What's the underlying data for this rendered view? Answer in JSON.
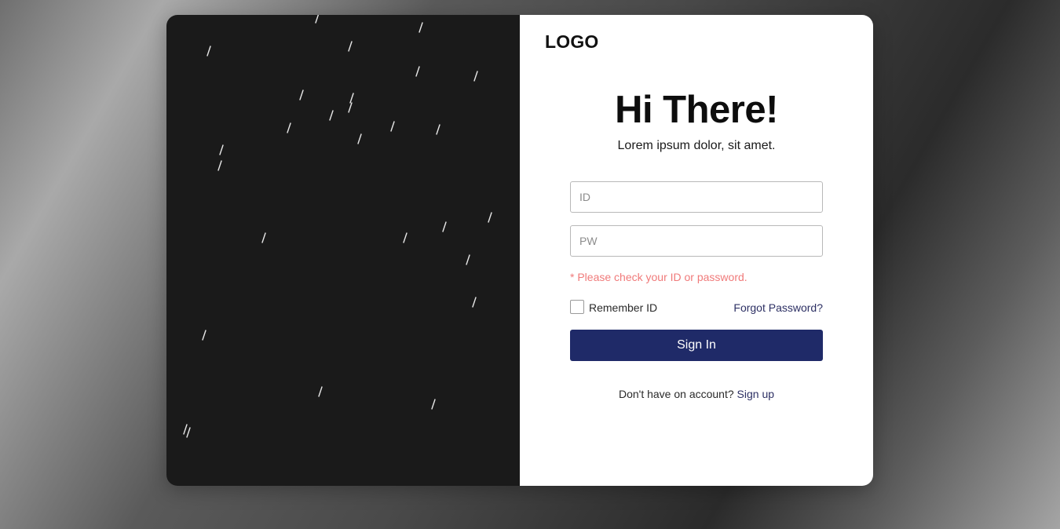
{
  "brand": {
    "logo_text": "LOGO"
  },
  "login": {
    "title": "Hi There!",
    "subtitle": "Lorem ipsum dolor, sit amet.",
    "id_placeholder": "ID",
    "pw_placeholder": "PW",
    "error_message": "* Please check your ID or password.",
    "remember_label": "Remember ID",
    "remember_checked": false,
    "forgot_label": "Forgot Password?",
    "submit_label": "Sign In",
    "signup_prompt": "Don't have on account?",
    "signup_label": "Sign up"
  },
  "colors": {
    "primary_button": "#1f2a68",
    "link": "#2d3064",
    "error": "#f07a7a",
    "left_panel": "#1a1a1a"
  }
}
